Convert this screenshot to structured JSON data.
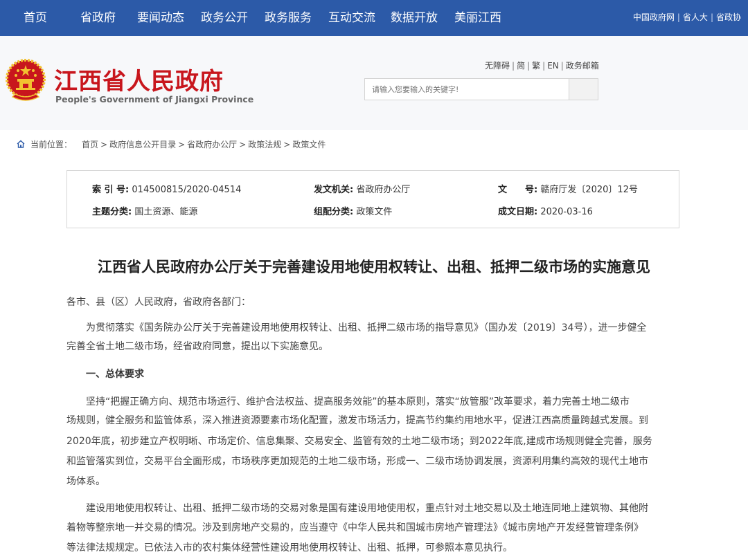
{
  "topnav": {
    "items": [
      "首页",
      "省政府",
      "要闻动态",
      "政务公开",
      "政务服务",
      "互动交流",
      "数据开放",
      "美丽江西"
    ],
    "right_links": [
      "中国政府网",
      "省人大",
      "省政协"
    ]
  },
  "header": {
    "title": "江西省人民政府",
    "subtitle": "People's Government of Jiangxi Province",
    "util_links": [
      "无障碍",
      "简",
      "繁",
      "EN",
      "政务邮箱"
    ],
    "search_placeholder": "请输入您要输入的关键字!"
  },
  "breadcrumb": {
    "label": "当前位置：",
    "items": [
      "首页",
      "政府信息公开目录",
      "省政府办公厅",
      "政策法规",
      "政策文件"
    ]
  },
  "meta": {
    "index_label": "索 引 号:",
    "index_value": "014500815/2020-04514",
    "issuer_label": "发文机关:",
    "issuer_value": "省政府办公厅",
    "docno_label": "文　　号:",
    "docno_value": "赣府厅发〔2020〕12号",
    "topic_label": "主题分类:",
    "topic_value": "国土资源、能源",
    "category_label": "组配分类:",
    "category_value": "政策文件",
    "date_label": "成文日期:",
    "date_value": "2020-03-16"
  },
  "article": {
    "title": "江西省人民政府办公厅关于完善建设用地使用权转让、出租、抵押二级市场的实施意见",
    "salutation": "各市、县（区）人民政府，省政府各部门：",
    "intro_line1": "为贯彻落实《国务院办公厅关于完善建设用地使用权转让、出租、抵押二级市场的指导意见》（国办发〔2019〕34号），进一步健全",
    "intro_line2": "完善全省土地二级市场，经省政府同意，提出以下实施意见。",
    "section1": "一、总体要求",
    "p1_line1": "坚持“把握正确方向、规范市场运行、维护合法权益、提高服务效能”的基本原则，落实“放管服”改革要求，着力完善土地二级市",
    "p1_line2": "场规则，健全服务和监管体系，深入推进资源要素市场化配置，激发市场活力，提高节约集约用地水平，促进江西高质量跨越式发展。到",
    "p1_line3": "2020年底，初步建立产权明晰、市场定价、信息集聚、交易安全、监管有效的土地二级市场；到2022年底,建成市场规则健全完善，服务",
    "p1_line4": "和监管落实到位，交易平台全面形成，市场秩序更加规范的土地二级市场，形成一、二级市场协调发展，资源利用集约高效的现代土地市",
    "p1_line5": "场体系。",
    "p2_line1": "建设用地使用权转让、出租、抵押二级市场的交易对象是国有建设用地使用权，重点针对土地交易以及土地连同地上建筑物、其他附",
    "p2_line2": "着物等整宗地一并交易的情况。涉及到房地产交易的，应当遵守《中华人民共和国城市房地产管理法》《城市房地产开发经营管理条例》",
    "p2_line3": "等法律法规规定。已依法入市的农村集体经营性建设用地使用权转让、出租、抵押，可参照本意见执行。"
  },
  "colors": {
    "nav_bg": "#2c5aa8",
    "brand_red": "#c8161d",
    "emblem_gold": "#f2c230"
  }
}
